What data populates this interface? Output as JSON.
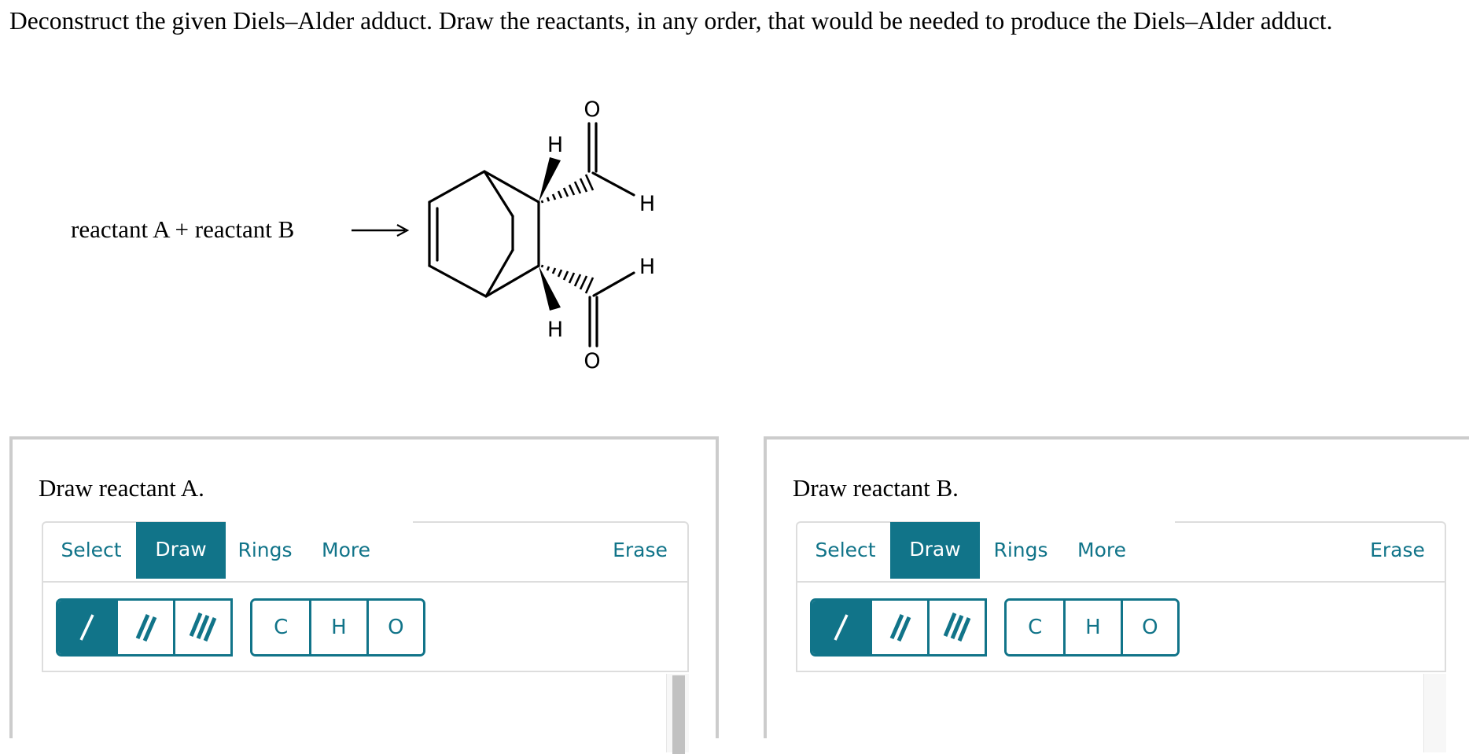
{
  "prompt": {
    "text": "Deconstruct the given Diels–Alder adduct. Draw the reactants, in any order, that would be needed to produce the Diels–Alder adduct."
  },
  "scheme": {
    "reaction_text": "reactant A + reactant B",
    "arrow_icon": "right-arrow",
    "product_name": "Diels–Alder adduct (bicyclo[2.2.2]oct-5-ene-2,3-dicarbaldehyde)",
    "atom_labels": {
      "o_top": "O",
      "o_bottom": "O",
      "h_wedge_top": "H",
      "h_wedge_bottom": "H",
      "h_cho_top": "H",
      "h_cho_bottom": "H"
    }
  },
  "panels": [
    {
      "title": "Draw reactant A.",
      "tabs": [
        {
          "label": "Select",
          "active": false
        },
        {
          "label": "Draw",
          "active": true
        },
        {
          "label": "Rings",
          "active": false
        },
        {
          "label": "More",
          "active": false
        }
      ],
      "erase_label": "Erase",
      "bond_buttons": [
        {
          "icon": "single-bond-icon",
          "active": true
        },
        {
          "icon": "double-bond-icon",
          "active": false
        },
        {
          "icon": "triple-bond-icon",
          "active": false
        }
      ],
      "atom_buttons": [
        "C",
        "H",
        "O"
      ]
    },
    {
      "title": "Draw reactant B.",
      "tabs": [
        {
          "label": "Select",
          "active": false
        },
        {
          "label": "Draw",
          "active": true
        },
        {
          "label": "Rings",
          "active": false
        },
        {
          "label": "More",
          "active": false
        }
      ],
      "erase_label": "Erase",
      "bond_buttons": [
        {
          "icon": "single-bond-icon",
          "active": true
        },
        {
          "icon": "double-bond-icon",
          "active": false
        },
        {
          "icon": "triple-bond-icon",
          "active": false
        }
      ],
      "atom_buttons": [
        "C",
        "H",
        "O"
      ]
    }
  ],
  "colors": {
    "accent": "#117489",
    "panel_border": "#cccccc",
    "toolbar_border": "#dddddd"
  }
}
